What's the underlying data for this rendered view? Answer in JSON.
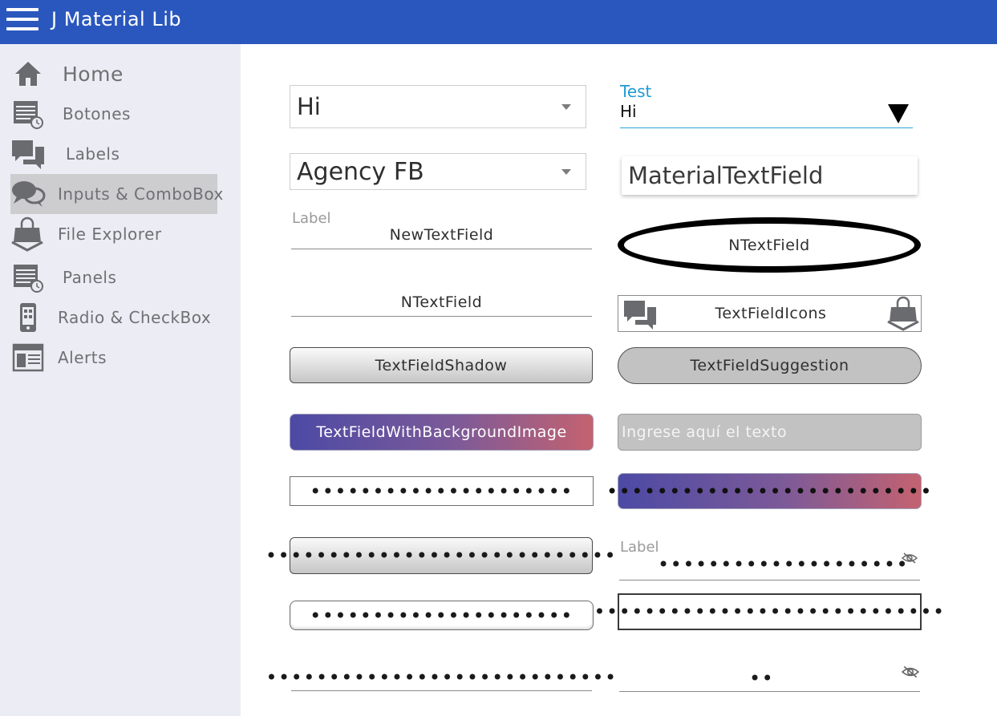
{
  "app": {
    "title": "J Material Lib"
  },
  "sidebar": {
    "items": [
      {
        "label": "Home",
        "icon": "home-icon"
      },
      {
        "label": "Botones",
        "icon": "calendar-clock-icon"
      },
      {
        "label": "Labels",
        "icon": "chat-icon"
      },
      {
        "label": "Inputs & ComboBox",
        "icon": "speech-bubbles-icon",
        "active": true
      },
      {
        "label": "File Explorer",
        "icon": "shopping-bag-icon"
      },
      {
        "label": "Panels",
        "icon": "calendar-clock-icon"
      },
      {
        "label": "Radio & CheckBox",
        "icon": "mobile-phone-icon"
      },
      {
        "label": "Alerts",
        "icon": "browser-window-icon"
      }
    ]
  },
  "fields": {
    "combo_hi": "Hi",
    "material_combo": {
      "label": "Test",
      "value": "Hi"
    },
    "combo_font": "Agency FB",
    "material_textfield": "MaterialTextField",
    "new_textfield": {
      "label": "Label",
      "value": "NewTextField"
    },
    "ntextfield_oval": "NTextField",
    "ntextfield_line": "NTextField",
    "textfield_icons": "TextFieldIcons",
    "textfield_shadow": "TextFieldShadow",
    "textfield_suggestion": "TextFieldSuggestion",
    "textfield_bg_image": "TextFieldWithBackgroundImage",
    "placeholder_field": "Ingrese aquí el texto",
    "password_1": "•••••••••••••••••••••",
    "password_2": "••••••••••••••••••••••••••",
    "password_3": "••••••••••••••••••••••••••••",
    "password_4": {
      "label": "Label",
      "value": "••••••••••••••••••••"
    },
    "password_5": "•••••••••••••••••••••",
    "password_6": "••••••••••••••••••••••••••••",
    "password_7": "••••••••••••••••••••••••••••",
    "password_8": "••"
  },
  "colors": {
    "topbar": "#2a57bd",
    "sidebar": "#ececf4",
    "accent": "#1e9ad6",
    "active_item": "#cdcdcf"
  }
}
